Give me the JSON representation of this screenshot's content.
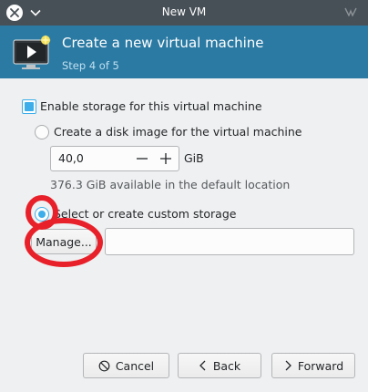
{
  "window": {
    "title": "New VM"
  },
  "header": {
    "title": "Create a new virtual machine",
    "step": "Step 4 of 5"
  },
  "storage": {
    "enable_label": "Enable storage for this virtual machine",
    "enable_checked": true,
    "disk_option_label": "Create a disk image for the virtual machine",
    "disk_size_value": "40,0",
    "disk_size_unit": "GiB",
    "available_text": "376.3 GiB available in the default location",
    "custom_option_label": "Select or create custom storage",
    "custom_selected": true,
    "manage_label": "Manage...",
    "custom_path_value": ""
  },
  "buttons": {
    "cancel": "Cancel",
    "back": "Back",
    "forward": "Forward"
  },
  "icons": {
    "close": "close-icon",
    "chevron": "chevron-down-icon",
    "monitor": "monitor-icon",
    "cancel": "cancel-icon",
    "back": "chevron-left-icon",
    "forward": "chevron-right-icon"
  },
  "colors": {
    "header_bg": "#2b7aa3",
    "accent": "#3daee9",
    "annotation": "#e8202a"
  }
}
